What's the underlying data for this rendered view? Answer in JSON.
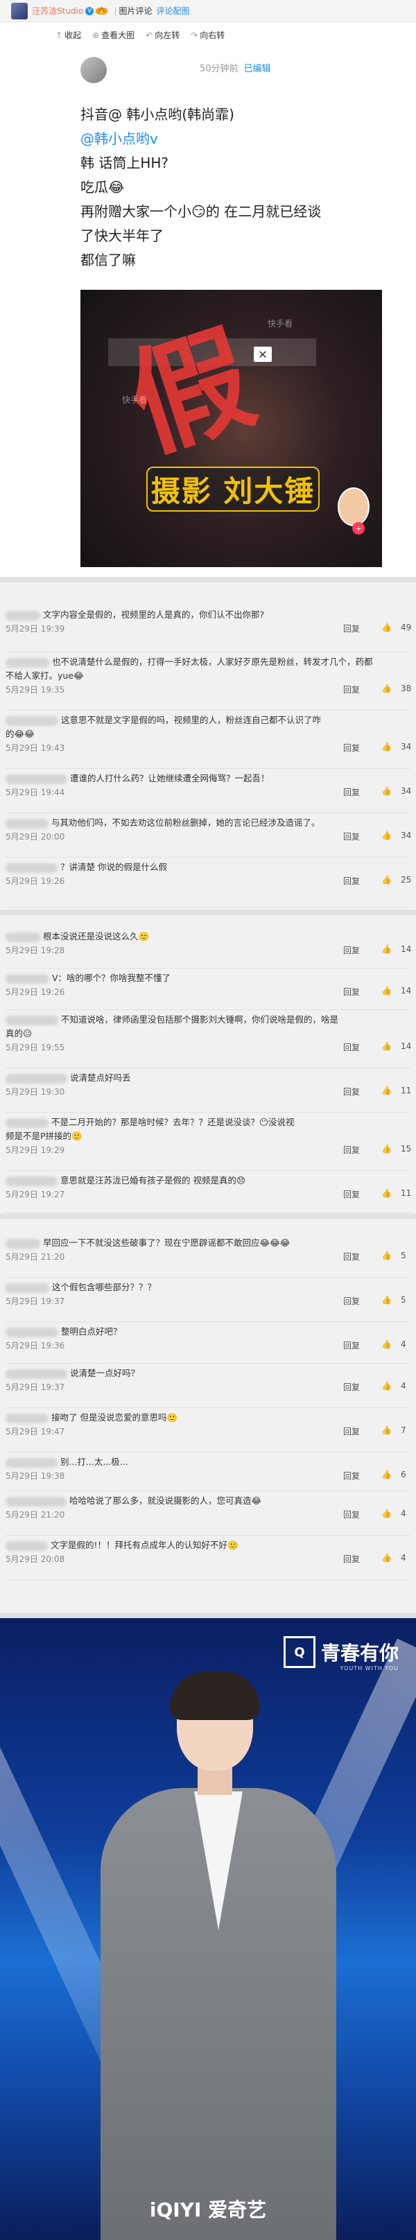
{
  "header": {
    "username": "汪苏泷Studio",
    "verified_mark": "V",
    "level": "🔥",
    "links": [
      "图片评论",
      "评论配图"
    ],
    "separator": "|"
  },
  "toolbar": {
    "items": [
      {
        "icon": "collapse-icon",
        "glyph": "↑",
        "label": "收起"
      },
      {
        "icon": "zoom-icon",
        "glyph": "⊕",
        "label": "查看大图"
      },
      {
        "icon": "rotate-left-icon",
        "glyph": "↶",
        "label": "向左转"
      },
      {
        "icon": "rotate-right-icon",
        "glyph": "↷",
        "label": "向右转"
      }
    ]
  },
  "post": {
    "time": "50分钟前",
    "edited": "已编辑",
    "lines": [
      "抖音@ 韩小点哟(韩尚霏)",
      "@韩小点哟v",
      "韩 话筒上HH?",
      "吃瓜😂",
      "再附赠大家一个小😏的     在二月就已经谈",
      "了快大半年了 ",
      "都信了嘛"
    ],
    "video": {
      "overlay_text": "假",
      "close": "✕",
      "logo_text": "摄影 刘大锤",
      "watermark": "快手看",
      "heart": "+"
    }
  },
  "comments_1": [
    {
      "text": "文字内容全是假的，视频里的人是真的，你们认不出你那?",
      "date": "5月29日 19:39",
      "reply": "回复",
      "likes": "49"
    },
    {
      "text": "也不说清楚什么是假的，打得一手好太极，人家好歹原先是粉丝，转发才几个，药都",
      "text2": "不给人家打。yue😂",
      "date": "5月29日 19:35",
      "reply": "回复",
      "likes": "38"
    },
    {
      "text": "这意思不就是文字是假的吗，视频里的人，粉丝连自己都不认识了咋",
      "text2": "的😂😂",
      "date": "5月29日 19:43",
      "reply": "回复",
      "likes": "34"
    },
    {
      "text": "遭谁的人打什么药？让她继续遭全网侮骂？一起吾！",
      "date": "5月29日 19:44",
      "reply": "回复",
      "likes": "34"
    },
    {
      "text": "与其劝他们吗，不如去劝这位前粉丝删掉，她的言论已经涉及造谣了。",
      "date": "5月29日 20:00",
      "reply": "回复",
      "likes": "34"
    },
    {
      "text": "？讲清楚 你说的假是什么假",
      "date": "5月29日 19:26",
      "reply": "回复",
      "likes": "25"
    }
  ],
  "comments_2": [
    {
      "text": "根本没说还是没说这么久🙂",
      "date": "5月29日 19:28",
      "reply": "回复",
      "likes": "14"
    },
    {
      "text": "V：啥的哪个？你啥我整不懂了",
      "date": "5月29日 19:26",
      "reply": "回复",
      "likes": "14"
    },
    {
      "text": "不知道说啥，律师函里没包括那个摄影刘大锤啊，你们说啥是假的，啥是",
      "text2": "真的😐",
      "date": "5月29日 19:55",
      "reply": "回复",
      "likes": "14"
    },
    {
      "text": "说清楚点好吗丢",
      "date": "5月29日 19:30",
      "reply": "回复",
      "likes": "11"
    },
    {
      "text": "不是二月开始的？那是啥时候？去年？？还是说没谈？😶没说视",
      "text2": "频是不是P拼接的🙂",
      "date": "5月29日 19:29",
      "reply": "回复",
      "likes": "15"
    },
    {
      "text": "意思就是汪苏泷已婚有孩子是假的 视频是真的😞",
      "date": "5月29日 19:27",
      "reply": "回复",
      "likes": "11"
    }
  ],
  "comments_3": [
    {
      "text": "早回应一下不就没这些破事了？现在宁愿辟谣都不敢回应😂😂😂",
      "date": "5月29日 21:20",
      "reply": "回复",
      "likes": "5"
    },
    {
      "text": "这个假包含哪些部分？？？",
      "date": "5月29日 19:37",
      "reply": "回复",
      "likes": "5"
    },
    {
      "text": "整明白点好吧？",
      "date": "5月29日 19:36",
      "reply": "回复",
      "likes": "4"
    },
    {
      "text": "说清楚一点好吗？",
      "date": "5月29日 19:37",
      "reply": "回复",
      "likes": "4"
    },
    {
      "text": "接吻了 但是没说恋爱的意思吗🙂",
      "date": "5月29日 19:47",
      "reply": "回复",
      "likes": "7"
    },
    {
      "text": "别...打...太...极...",
      "date": "5月29日 19:38",
      "reply": "回复",
      "likes": "6"
    },
    {
      "text": "哈哈哈说了那么多，就没说摄影的人，您可真造😂",
      "date": "5月29日 21:20",
      "reply": "回复",
      "likes": "4"
    },
    {
      "text": "文字是假的!！！拜托有点成年人的认知好不好🙂",
      "date": "5月29日 20:08",
      "reply": "回复",
      "likes": "4"
    }
  ],
  "photo": {
    "brand": "青春有你",
    "brand_box": "Q",
    "brand_sub": "YOUTH WITH YOU",
    "watermark": "iQIYI 爱奇艺"
  }
}
